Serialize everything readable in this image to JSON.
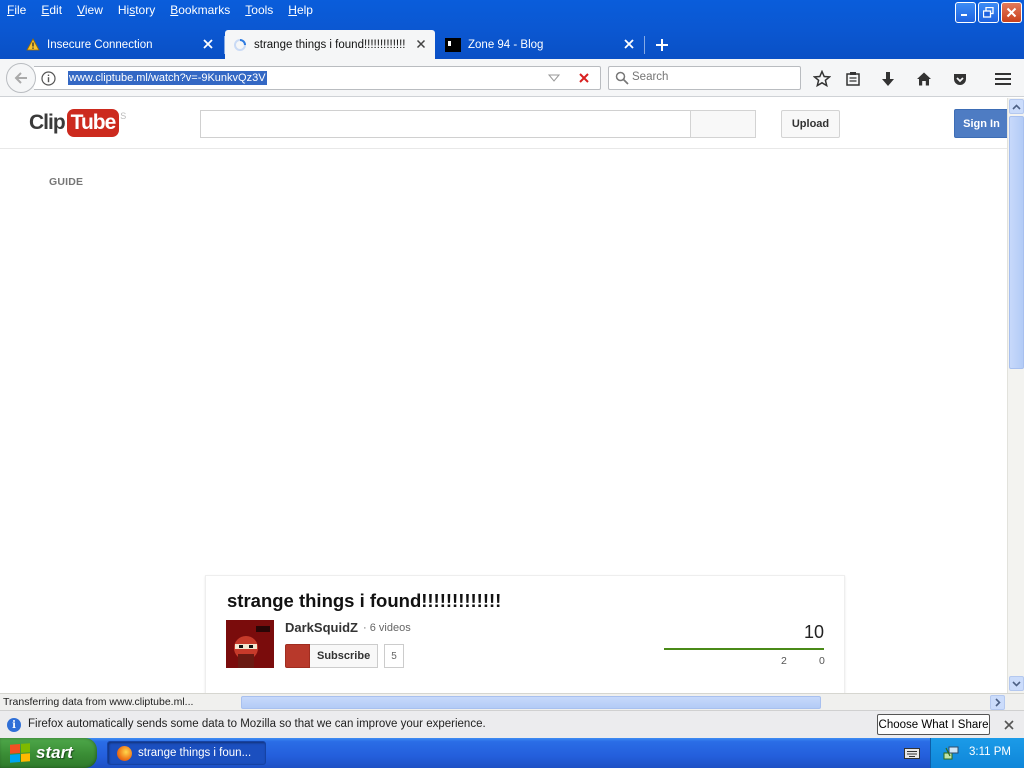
{
  "window": {
    "menu": [
      "File",
      "Edit",
      "View",
      "History",
      "Bookmarks",
      "Tools",
      "Help"
    ],
    "menu_access": [
      "F",
      "E",
      "V",
      "s",
      "B",
      "T",
      "H"
    ]
  },
  "tabs": [
    {
      "title": "Insecure Connection",
      "icon": "warning-icon"
    },
    {
      "title": "strange things i found!!!!!!!!!!!!!",
      "icon": "loading-icon",
      "active": true
    },
    {
      "title": "Zone 94 - Blog",
      "icon": "site-favicon"
    }
  ],
  "navbar": {
    "url": "www.cliptube.ml/watch?v=-9KunkvQz3V",
    "search_placeholder": "Search"
  },
  "page": {
    "logo_clip": "Clip",
    "logo_tube": "Tube",
    "logo_tm": "S",
    "upload_label": "Upload",
    "signin_label": "Sign In",
    "guide_label": "GUIDE",
    "video": {
      "title": "strange things i found!!!!!!!!!!!!!",
      "channel": "DarkSquidZ",
      "channel_meta": "· 6 videos",
      "subscribe_label": "Subscribe",
      "subscriber_count": "5",
      "views": "10",
      "likes": "2",
      "dislikes": "0"
    }
  },
  "status": {
    "text": "Transferring data from www.cliptube.ml..."
  },
  "notification": {
    "text": "Firefox automatically sends some data to Mozilla so that we can improve your experience.",
    "button": "Choose What I Share"
  },
  "taskbar": {
    "start_label": "start",
    "item": "strange things i foun...",
    "clock": "3:11 PM"
  },
  "colors": {
    "accent": "#0a5ddb",
    "brand_red": "#cc2a1e",
    "signin_blue": "#4e7cc3",
    "like_green": "#4a8a18"
  }
}
